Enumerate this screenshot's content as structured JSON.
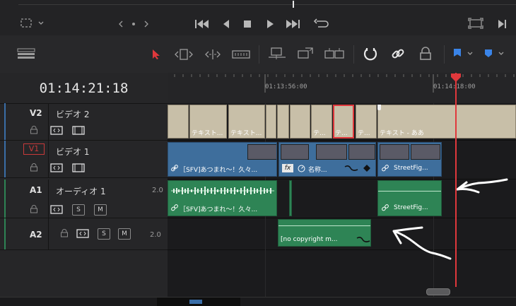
{
  "timecode": "01:14:21:18",
  "ruler": {
    "tc1": "01:13:56:00",
    "tc2": "01:14:18:00"
  },
  "tracks": {
    "v2": {
      "id": "V2",
      "name": "ビデオ 2"
    },
    "v1": {
      "id": "V1",
      "name": "ビデオ 1"
    },
    "a1": {
      "id": "A1",
      "name": "オーディオ 1",
      "level": "2.0"
    },
    "a2": {
      "id": "A2",
      "level": "2.0"
    }
  },
  "buttons": {
    "solo": "S",
    "mute": "M"
  },
  "clips": {
    "text1": "テキスト...",
    "text2": "テキスト...",
    "text3": "テ...",
    "text4": "テ...",
    "text5": "テ...",
    "text6": "テキスト - ああ",
    "v1_a": "［SFV]あつまれ～！久々...",
    "v1_fx": "fx",
    "v1_b": "名称...",
    "v1_c": "StreetFig...",
    "a1_a": "［SFV]あつまれ～！久々...",
    "a1_b": "StreetFig...",
    "a2_a": "[no copyright m..."
  },
  "colors": {
    "video_clip": "#3e6e9c",
    "audio_clip": "#2e8455",
    "title_clip": "#c8bfa8",
    "playhead": "#e0383c",
    "selection": "#e0383c"
  },
  "icons": [
    "rewind-icon",
    "step-back-icon",
    "stop-icon",
    "play-icon",
    "fast-forward-icon",
    "loop-icon",
    "select-icon",
    "trim-icon",
    "blade-icon",
    "snap-icon",
    "link-icon",
    "lock-icon",
    "flag-icon",
    "marker-icon"
  ]
}
